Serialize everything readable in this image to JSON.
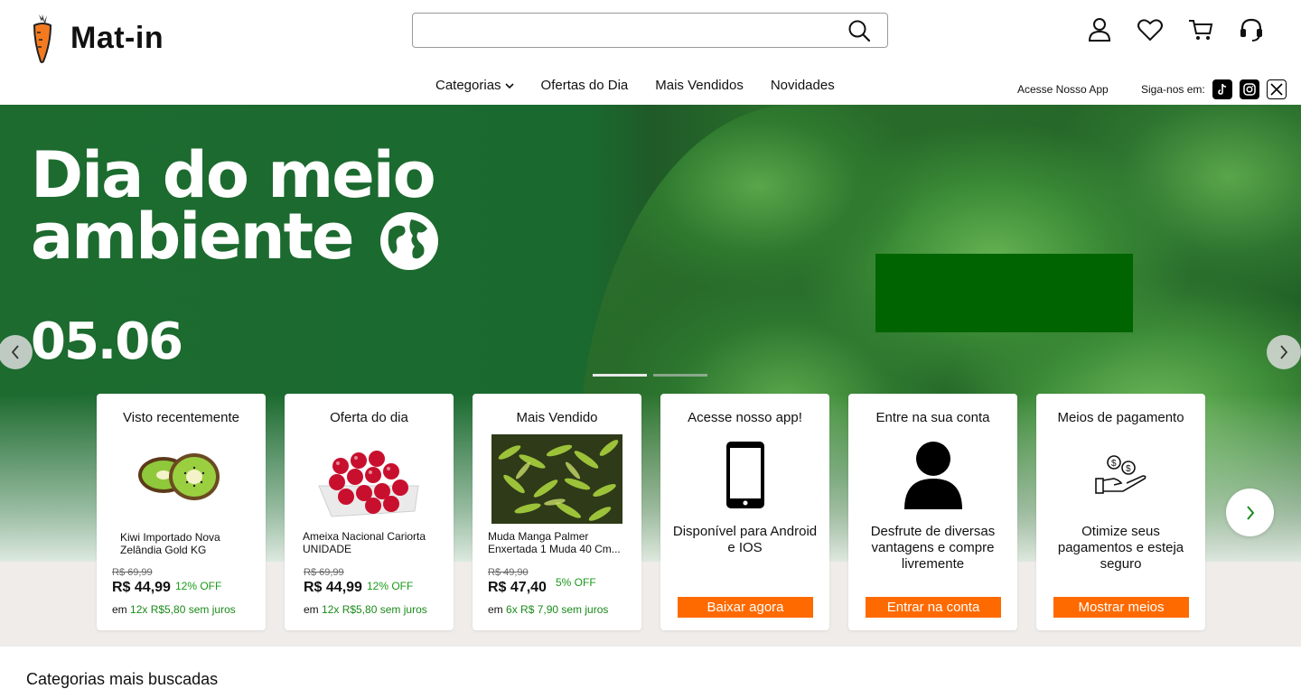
{
  "header": {
    "logo_text": "Mat-in",
    "search": {
      "value": "",
      "placeholder": ""
    },
    "icons": [
      "user-icon",
      "heart-icon",
      "cart-icon",
      "headset-icon"
    ]
  },
  "nav": {
    "items": [
      {
        "label": "Categorias",
        "has_dropdown": true
      },
      {
        "label": "Ofertas do Dia"
      },
      {
        "label": "Mais Vendidos"
      },
      {
        "label": "Novidades"
      }
    ],
    "app_link": "Acesse Nosso App",
    "follow_label": "Siga-nos em:",
    "social": [
      "tiktok-icon",
      "instagram-icon",
      "x-icon"
    ]
  },
  "hero": {
    "title_line1": "Dia do meio",
    "title_line2": "ambiente",
    "date": "05.06",
    "slides": 2,
    "active_slide": 1,
    "box_color": "#006400"
  },
  "cards": [
    {
      "title": "Visto recentemente",
      "product": "Kiwi Importado Nova Zelândia Gold KG",
      "old_price": "R$ 69,99",
      "price": "R$ 44,99",
      "discount": "12% OFF",
      "inst_prefix": "em ",
      "installments": "12x R$5,80 sem juros"
    },
    {
      "title": "Oferta do dia",
      "product": "Ameixa Nacional Cariorta UNIDADE",
      "old_price": "R$ 69,99",
      "price": "R$ 44,99",
      "discount": "12% OFF",
      "inst_prefix": "em ",
      "installments": "12x R$5,80 sem juros"
    },
    {
      "title": "Mais Vendido",
      "product": "Muda Manga Palmer Enxertada 1 Muda 40 Cm...",
      "old_price": "R$ 49,90",
      "price": "R$ 47,40",
      "discount": "5% OFF",
      "inst_prefix": "em ",
      "installments": "6x R$ 7,90 sem juros"
    },
    {
      "title": "Acesse nosso app!",
      "description": "Disponível para Android e IOS",
      "button": "Baixar agora"
    },
    {
      "title": "Entre na sua conta",
      "description": "Desfrute de diversas vantagens e compre livremente",
      "button": "Entrar na conta"
    },
    {
      "title": "Meios de pagamento",
      "description": "Otimize seus pagamentos e esteja seguro",
      "button": "Mostrar meios"
    }
  ],
  "sections": {
    "popular_categories": "Categorias mais buscadas"
  },
  "colors": {
    "accent": "#ff6a00",
    "discount": "#1a9a1a",
    "hero_green": "#1d6b2f"
  }
}
